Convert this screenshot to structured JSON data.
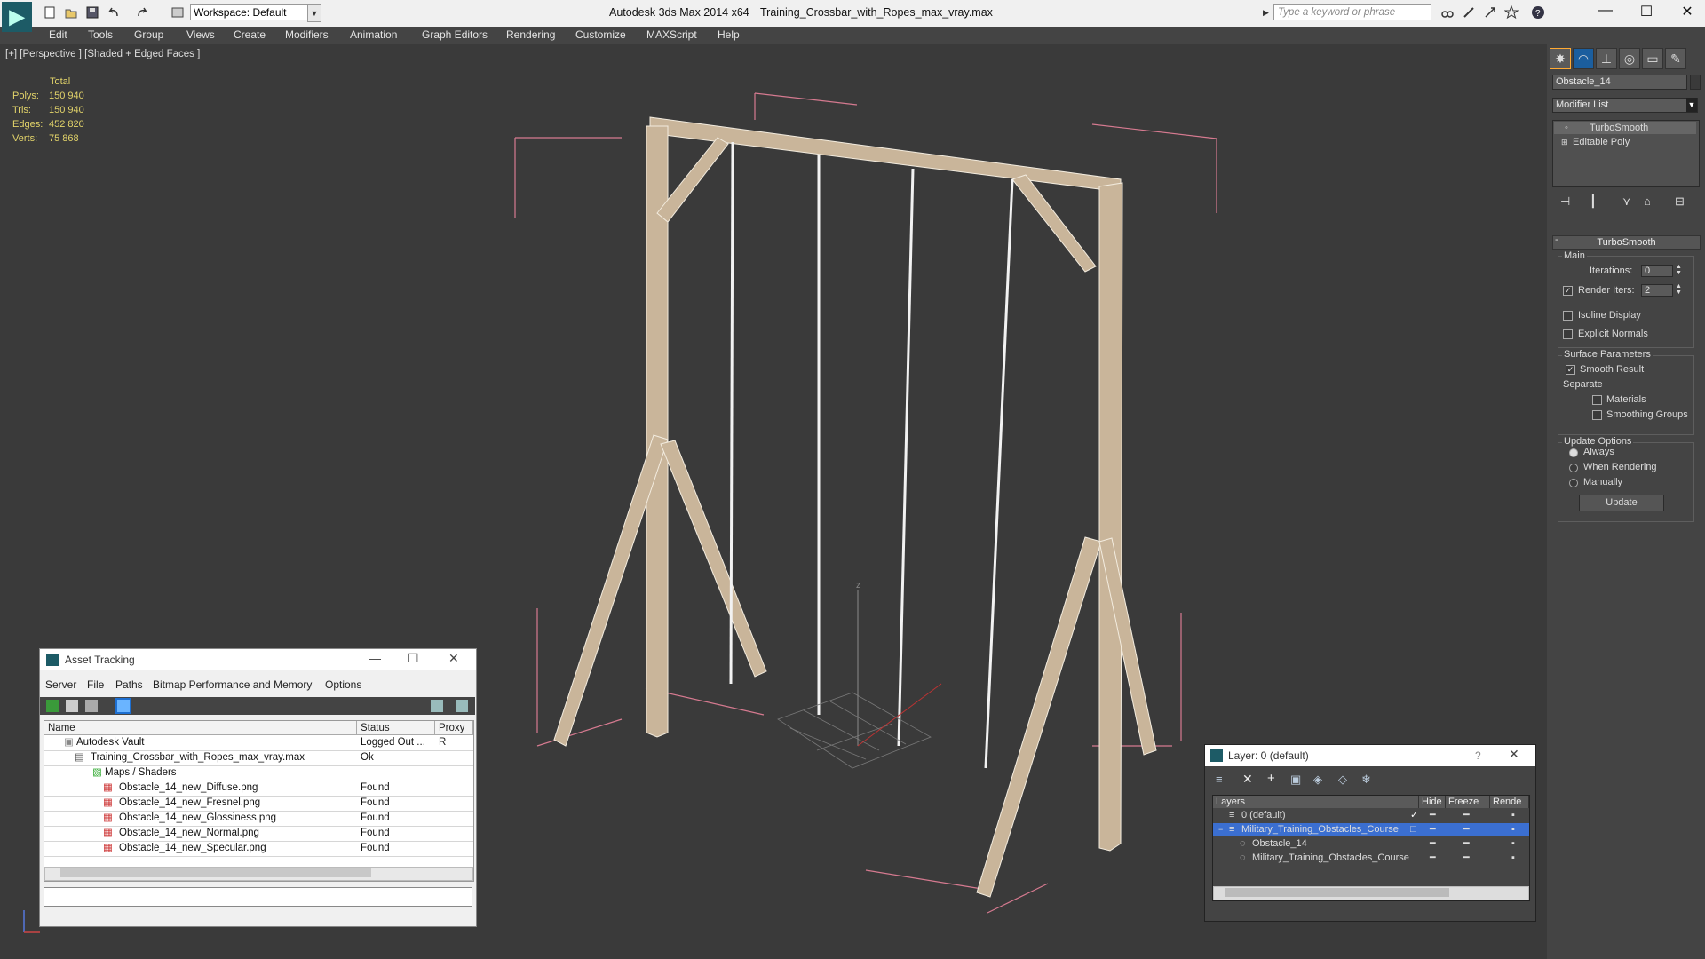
{
  "app": {
    "title": "Autodesk 3ds Max  2014 x64",
    "file": "Training_Crossbar_with_Ropes_max_vray.max",
    "workspace": "Workspace: Default",
    "search_placeholder": "Type a keyword or phrase"
  },
  "menu": [
    "Edit",
    "Tools",
    "Group",
    "Views",
    "Create",
    "Modifiers",
    "Animation",
    "Graph Editors",
    "Rendering",
    "Customize",
    "MAXScript",
    "Help"
  ],
  "viewport": {
    "label": "[+] [Perspective ] [Shaded + Edged Faces ]",
    "stats_header": "Total",
    "stats": [
      {
        "label": "Polys:",
        "value": "150 940"
      },
      {
        "label": "Tris:",
        "value": "150 940"
      },
      {
        "label": "Edges:",
        "value": "452 820"
      },
      {
        "label": "Verts:",
        "value": "75 868"
      }
    ],
    "axis_label": "z"
  },
  "command_panel": {
    "object_name": "Obstacle_14",
    "modifier_list": "Modifier List",
    "stack": [
      "TurboSmooth",
      "Editable Poly"
    ],
    "rollout": "TurboSmooth",
    "main_group": "Main",
    "iterations_label": "Iterations:",
    "iterations": "0",
    "render_iters_label": "Render Iters:",
    "render_iters": "2",
    "isoline": "Isoline Display",
    "explicit": "Explicit Normals",
    "surface_group": "Surface Parameters",
    "smooth_result": "Smooth Result",
    "separate": "Separate",
    "materials": "Materials",
    "smoothing_groups": "Smoothing Groups",
    "update_group": "Update Options",
    "always": "Always",
    "when_rendering": "When Rendering",
    "manually": "Manually",
    "update_button": "Update"
  },
  "asset": {
    "title": "Asset Tracking",
    "menu": [
      "Server",
      "File",
      "Paths",
      "Bitmap Performance and Memory",
      "Options"
    ],
    "columns": [
      "Name",
      "Status",
      "Proxy R"
    ],
    "rows": [
      {
        "name": "Autodesk Vault",
        "status": "Logged Out ..."
      },
      {
        "name": "Training_Crossbar_with_Ropes_max_vray.max",
        "status": "Ok"
      },
      {
        "name": "Maps / Shaders",
        "status": ""
      },
      {
        "name": "Obstacle_14_new_Diffuse.png",
        "status": "Found"
      },
      {
        "name": "Obstacle_14_new_Fresnel.png",
        "status": "Found"
      },
      {
        "name": "Obstacle_14_new_Glossiness.png",
        "status": "Found"
      },
      {
        "name": "Obstacle_14_new_Normal.png",
        "status": "Found"
      },
      {
        "name": "Obstacle_14_new_Specular.png",
        "status": "Found"
      }
    ]
  },
  "layer": {
    "title": "Layer: 0 (default)",
    "help": "?",
    "columns": [
      "Layers",
      "Hide",
      "Freeze",
      "Rende"
    ],
    "rows": [
      "0 (default)",
      "Military_Training_Obstacles_Course",
      "Obstacle_14",
      "Military_Training_Obstacles_Course"
    ]
  }
}
